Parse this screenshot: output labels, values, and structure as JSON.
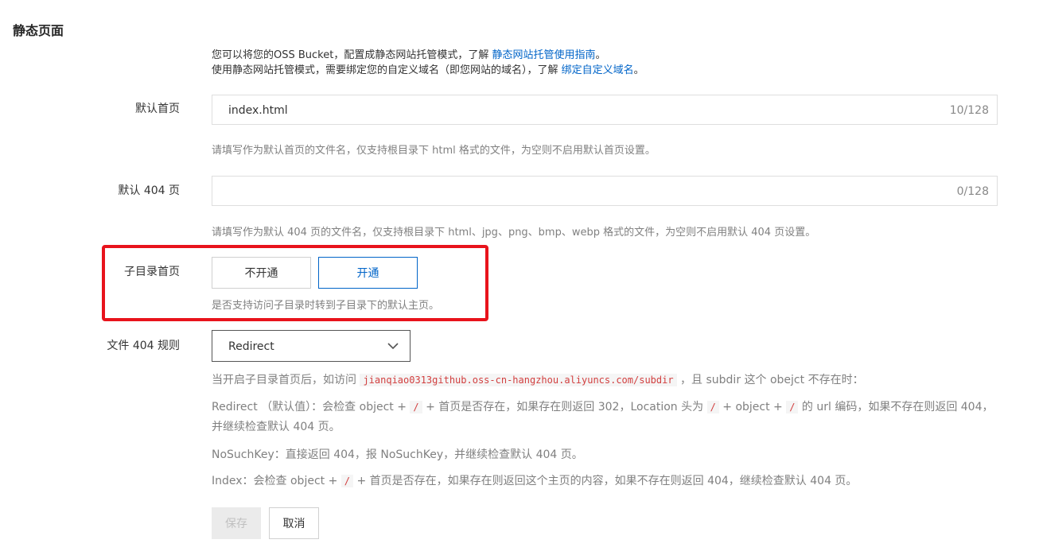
{
  "page": {
    "section_title": "静态页面"
  },
  "intro": {
    "line1_prefix": "您可以将您的OSS Bucket，配置成静态网站托管模式，了解 ",
    "line1_link": "静态网站托管使用指南",
    "line1_suffix": "。",
    "line2_prefix": "使用静态网站托管模式，需要绑定您的自定义域名（即您网站的域名），了解 ",
    "line2_link": "绑定自定义域名",
    "line2_suffix": "。"
  },
  "default_index": {
    "label": "默认首页",
    "value": "index.html",
    "count": "10/128",
    "help": "请填写作为默认首页的文件名，仅支持根目录下 html 格式的文件，为空则不启用默认首页设置。"
  },
  "default_404": {
    "label": "默认 404 页",
    "value": "",
    "count": "0/128",
    "help": "请填写作为默认 404 页的文件名，仅支持根目录下 html、jpg、png、bmp、webp 格式的文件，为空则不启用默认 404 页设置。"
  },
  "subdir_index": {
    "label": "子目录首页",
    "option_off": "不开通",
    "option_on": "开通",
    "selected": "开通",
    "help": "是否支持访问子目录时转到子目录下的默认主页。"
  },
  "file_404_rule": {
    "label": "文件 404 规则",
    "selected": "Redirect",
    "chevron_icon": "chevron-down-icon",
    "desc_intro_prefix": "当开启子目录首页后，如访问 ",
    "desc_intro_code": "jianqiao0313github.oss-cn-hangzhou.aliyuncs.com/subdir",
    "desc_intro_suffix": " ，且 subdir 这个 obejct 不存在时：",
    "redirect_p1": "Redirect （默认值）：会检查 object + ",
    "redirect_code1": "/",
    "redirect_p2": " + 首页是否存在，如果存在则返回 302，Location 头为 ",
    "redirect_code2": "/",
    "redirect_p3": " + object + ",
    "redirect_code3": "/",
    "redirect_p4": " 的 url 编码，如果不存在则返回 404，并继续检查默认 404 页。",
    "nosuchkey": "NoSuchKey：直接返回 404，报 NoSuchKey，并继续检查默认 404 页。",
    "index_p1": "Index：会检查 object + ",
    "index_code": "/",
    "index_p2": " + 首页是否存在，如果存在则返回这个主页的内容，如果不存在则返回 404，继续检查默认 404 页。"
  },
  "actions": {
    "save_label": "保存",
    "cancel_label": "取消"
  },
  "colors": {
    "link": "#0064c8",
    "highlight_box": "#e8131c"
  }
}
